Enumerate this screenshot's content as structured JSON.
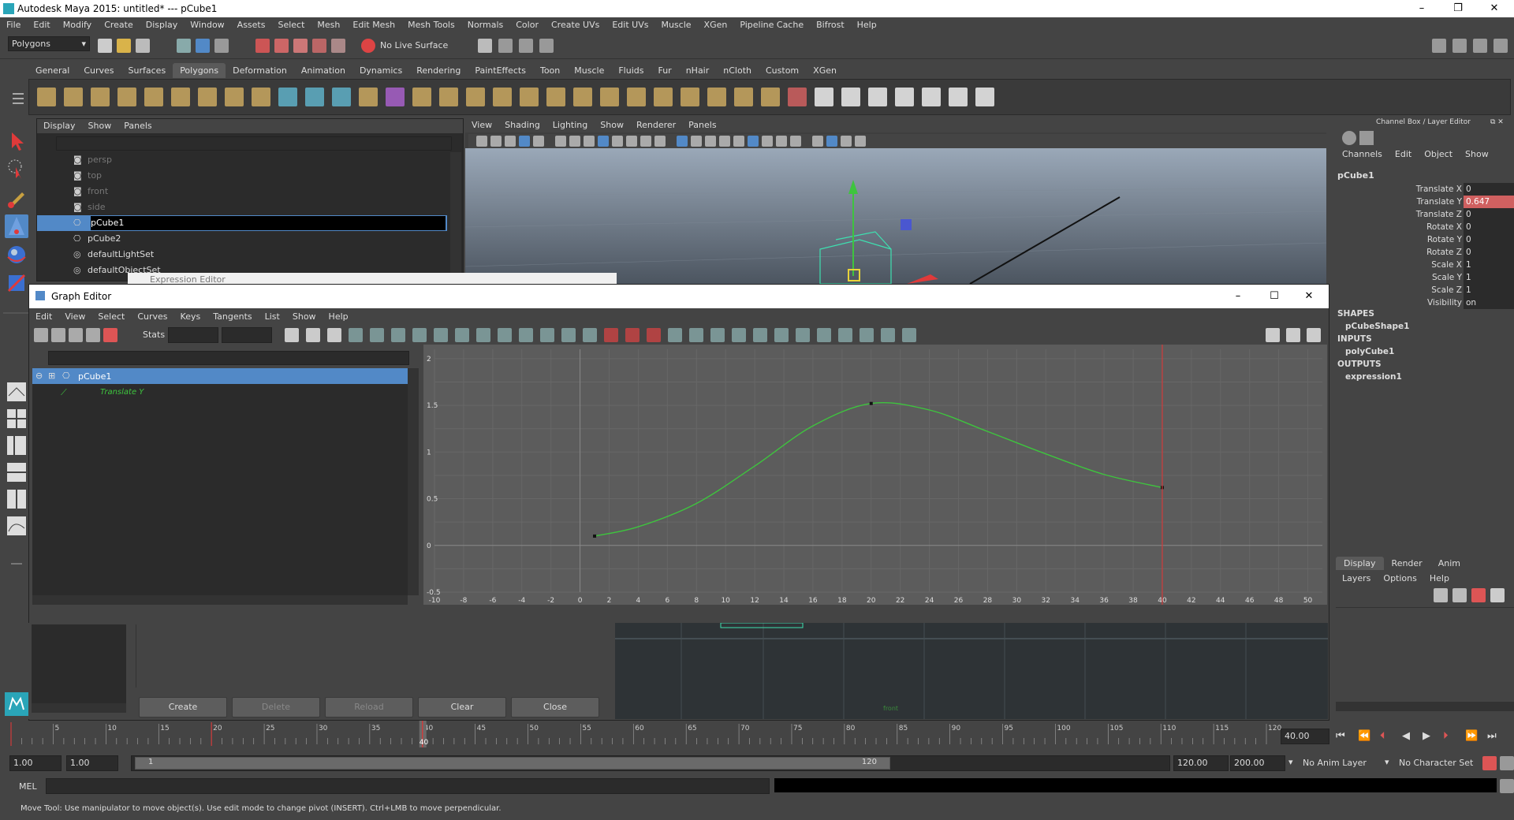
{
  "window": {
    "title": "Autodesk Maya 2015: untitled*   ---   pCube1"
  },
  "menubar": [
    "File",
    "Edit",
    "Modify",
    "Create",
    "Display",
    "Window",
    "Assets",
    "Select",
    "Mesh",
    "Edit Mesh",
    "Mesh Tools",
    "Normals",
    "Color",
    "Create UVs",
    "Edit UVs",
    "Muscle",
    "XGen",
    "Pipeline Cache",
    "Bifrost",
    "Help"
  ],
  "statusline": {
    "mode": "Polygons",
    "live_surface": "No Live Surface"
  },
  "shelf_tabs": [
    "General",
    "Curves",
    "Surfaces",
    "Polygons",
    "Deformation",
    "Animation",
    "Dynamics",
    "Rendering",
    "PaintEffects",
    "Toon",
    "Muscle",
    "Fluids",
    "Fur",
    "nHair",
    "nCloth",
    "Custom",
    "XGen"
  ],
  "shelf_active": "Polygons",
  "outliner": {
    "menu": [
      "Display",
      "Show",
      "Panels"
    ],
    "items": [
      "persp",
      "top",
      "front",
      "side",
      "pCube1",
      "pCube2",
      "defaultLightSet",
      "defaultObjectSet"
    ],
    "selected": "pCube1"
  },
  "viewport": {
    "menu": [
      "View",
      "Shading",
      "Lighting",
      "Show",
      "Renderer",
      "Panels"
    ]
  },
  "channel_box": {
    "header": "Channel Box / Layer Editor",
    "menu": [
      "Channels",
      "Edit",
      "Object",
      "Show"
    ],
    "object": "pCube1",
    "channels": [
      {
        "label": "Translate X",
        "value": "0"
      },
      {
        "label": "Translate Y",
        "value": "0.647"
      },
      {
        "label": "Translate Z",
        "value": "0"
      },
      {
        "label": "Rotate X",
        "value": "0"
      },
      {
        "label": "Rotate Y",
        "value": "0"
      },
      {
        "label": "Rotate Z",
        "value": "0"
      },
      {
        "label": "Scale X",
        "value": "1"
      },
      {
        "label": "Scale Y",
        "value": "1"
      },
      {
        "label": "Scale Z",
        "value": "1"
      },
      {
        "label": "Visibility",
        "value": "on"
      }
    ],
    "shapes_header": "SHAPES",
    "shape": "pCubeShape1",
    "inputs_header": "INPUTS",
    "input": "polyCube1",
    "outputs_header": "OUTPUTS",
    "output": "expression1"
  },
  "layer_editor": {
    "tabs": [
      "Display",
      "Render",
      "Anim"
    ],
    "menu": [
      "Layers",
      "Options",
      "Help"
    ]
  },
  "graph_editor": {
    "title": "Graph Editor",
    "behind_title": "Expression Editor",
    "menu": [
      "Edit",
      "View",
      "Select",
      "Curves",
      "Keys",
      "Tangents",
      "List",
      "Show",
      "Help"
    ],
    "stats_label": "Stats",
    "object": "pCube1",
    "curve": "Translate Y"
  },
  "chart_data": {
    "type": "line",
    "x_ticks": [
      -10,
      -8,
      -6,
      -4,
      -2,
      0,
      2,
      4,
      6,
      8,
      10,
      12,
      14,
      16,
      18,
      20,
      22,
      24,
      26,
      28,
      30,
      32,
      34,
      36,
      38,
      40,
      42,
      44,
      46,
      48,
      50
    ],
    "y_ticks": [
      -0.5,
      0,
      0.5,
      1,
      1.5,
      2
    ],
    "y_tick_labels": [
      "-0.5",
      "0",
      "0.5",
      "1",
      "1.5",
      "2"
    ],
    "xlim": [
      -10,
      51
    ],
    "ylim": [
      -0.5,
      2.1
    ],
    "current_time": 40,
    "keys": [
      {
        "x": 1,
        "y": 0.1
      },
      {
        "x": 20,
        "y": 1.52
      },
      {
        "x": 40,
        "y": 0.62
      }
    ],
    "series": [
      {
        "name": "Translate Y",
        "color": "#3ec43e",
        "points": [
          [
            1,
            0.1
          ],
          [
            4,
            0.2
          ],
          [
            8,
            0.45
          ],
          [
            12,
            0.85
          ],
          [
            16,
            1.28
          ],
          [
            20,
            1.52
          ],
          [
            24,
            1.45
          ],
          [
            28,
            1.22
          ],
          [
            32,
            0.98
          ],
          [
            36,
            0.76
          ],
          [
            40,
            0.62
          ]
        ]
      }
    ]
  },
  "expression_editor": {
    "buttons": [
      "Create",
      "Delete",
      "Reload",
      "Clear",
      "Close"
    ],
    "disabled": [
      "Delete",
      "Reload"
    ]
  },
  "dopesheet": {
    "label": "front"
  },
  "timeslider": {
    "ticks": [
      5,
      10,
      15,
      20,
      25,
      30,
      35,
      40,
      45,
      50,
      55,
      60,
      65,
      70,
      75,
      80,
      85,
      90,
      95,
      100,
      105,
      110,
      115,
      120
    ],
    "current": "40",
    "current_field": "40.00"
  },
  "range": {
    "start": "1.00",
    "start2": "1.00",
    "range_start": "1",
    "range_end": "120",
    "end": "120.00",
    "end2": "200.00",
    "anim_layer": "No Anim Layer",
    "char_set": "No Character Set"
  },
  "mel": {
    "label": "MEL"
  },
  "help_line": "Move Tool: Use manipulator to move object(s). Use edit mode to change pivot (INSERT).  Ctrl+LMB to move perpendicular.",
  "colors": {
    "accent": "#5289c7",
    "curve": "#3ec43e",
    "time": "#d03a3a",
    "highlight": "#d06060"
  }
}
